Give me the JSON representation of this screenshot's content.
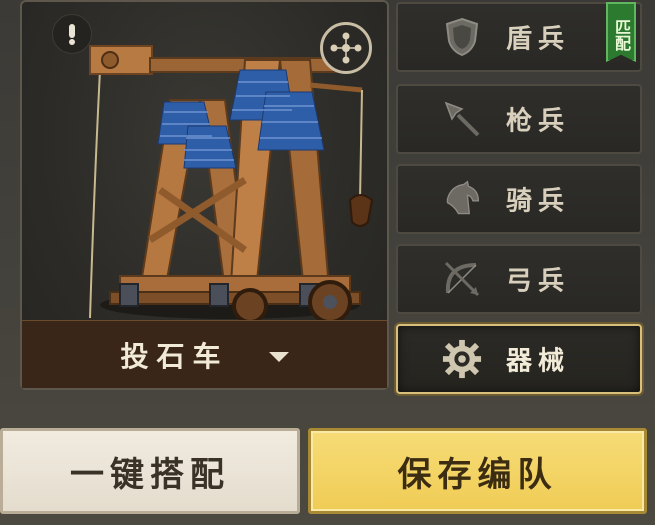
{
  "unit_preview": {
    "selected_unit": "投石车"
  },
  "tabs": [
    {
      "label": "盾兵",
      "icon": "shield-icon",
      "active": false,
      "tag": "匹配"
    },
    {
      "label": "枪兵",
      "icon": "spear-icon",
      "active": false
    },
    {
      "label": "骑兵",
      "icon": "horse-icon",
      "active": false
    },
    {
      "label": "弓兵",
      "icon": "bow-icon",
      "active": false
    },
    {
      "label": "器械",
      "icon": "gear-icon",
      "active": true
    }
  ],
  "buttons": {
    "auto_equip": "一键搭配",
    "save_formation": "保存编队"
  },
  "colors": {
    "active_border": "#d9bf7c",
    "match_tag": "#2c7a2f",
    "save_button": "#f0cc55"
  }
}
